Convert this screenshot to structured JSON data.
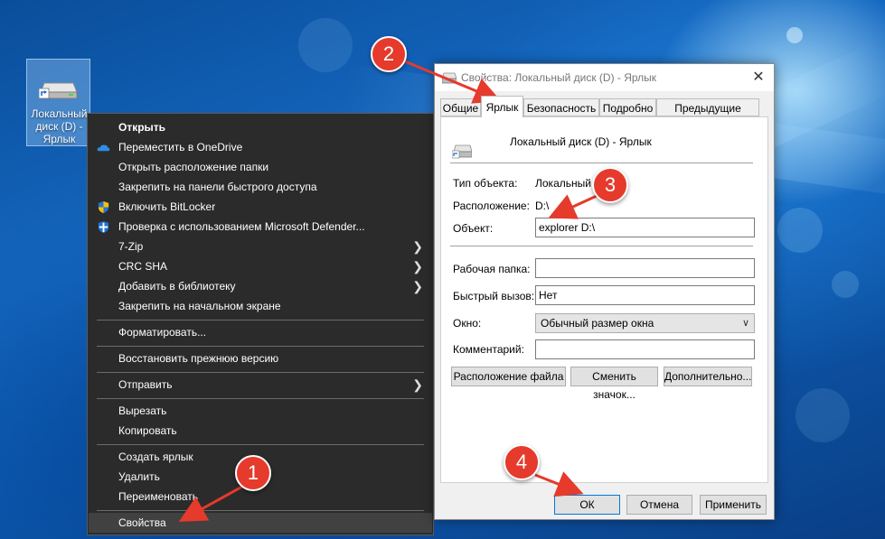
{
  "desktop": {
    "icon_label": "Локальный диск (D) - Ярлык"
  },
  "context_menu": {
    "items": [
      {
        "label": "Открыть",
        "bold": true,
        "icon": ""
      },
      {
        "label": "Переместить в OneDrive",
        "icon": "onedrive-icon"
      },
      {
        "label": "Открыть расположение папки",
        "icon": ""
      },
      {
        "label": "Закрепить на панели быстрого доступа",
        "icon": ""
      },
      {
        "label": "Включить BitLocker",
        "icon": "shield-uac-icon"
      },
      {
        "label": "Проверка с использованием Microsoft Defender...",
        "icon": "defender-icon"
      },
      {
        "label": "7-Zip",
        "submenu": true
      },
      {
        "label": "CRC SHA",
        "submenu": true
      },
      {
        "label": "Добавить в библиотеку",
        "submenu": true
      },
      {
        "label": "Закрепить на начальном экране"
      },
      {
        "label": "Форматировать..."
      },
      {
        "label": "Восстановить прежнюю версию"
      },
      {
        "label": "Отправить",
        "submenu": true
      },
      {
        "label": "Вырезать"
      },
      {
        "label": "Копировать"
      },
      {
        "label": "Создать ярлык"
      },
      {
        "label": "Удалить"
      },
      {
        "label": "Переименовать"
      },
      {
        "label": "Свойства",
        "highlighted": true
      }
    ]
  },
  "dialog": {
    "title": "Свойства: Локальный диск (D) - Ярлык",
    "tabs": [
      "Общие",
      "Ярлык",
      "Безопасность",
      "Подробно",
      "Предыдущие версии"
    ],
    "active_tab": "Ярлык",
    "shortcut_name": "Локальный диск (D) - Ярлык",
    "type_label": "Тип объекта:",
    "type_value": "Локальный д",
    "location_label": "Расположение:",
    "location_value": "D:\\",
    "target_label": "Объект:",
    "target_value": "explorer D:\\",
    "start_in_label": "Рабочая папка:",
    "start_in_value": "",
    "hotkey_label": "Быстрый вызов:",
    "hotkey_value": "Нет",
    "run_label": "Окно:",
    "run_value": "Обычный размер окна",
    "comment_label": "Комментарий:",
    "comment_value": "",
    "open_location_button": "Расположение файла",
    "change_icon_button": "Сменить значок...",
    "advanced_button": "Дополнительно...",
    "ok_button": "ОК",
    "cancel_button": "Отмена",
    "apply_button": "Применить"
  },
  "callouts": [
    "1",
    "2",
    "3",
    "4"
  ],
  "colors": {
    "callout": "#e53a2c",
    "menu_bg": "#2b2b2b",
    "accent": "#0078d7"
  }
}
